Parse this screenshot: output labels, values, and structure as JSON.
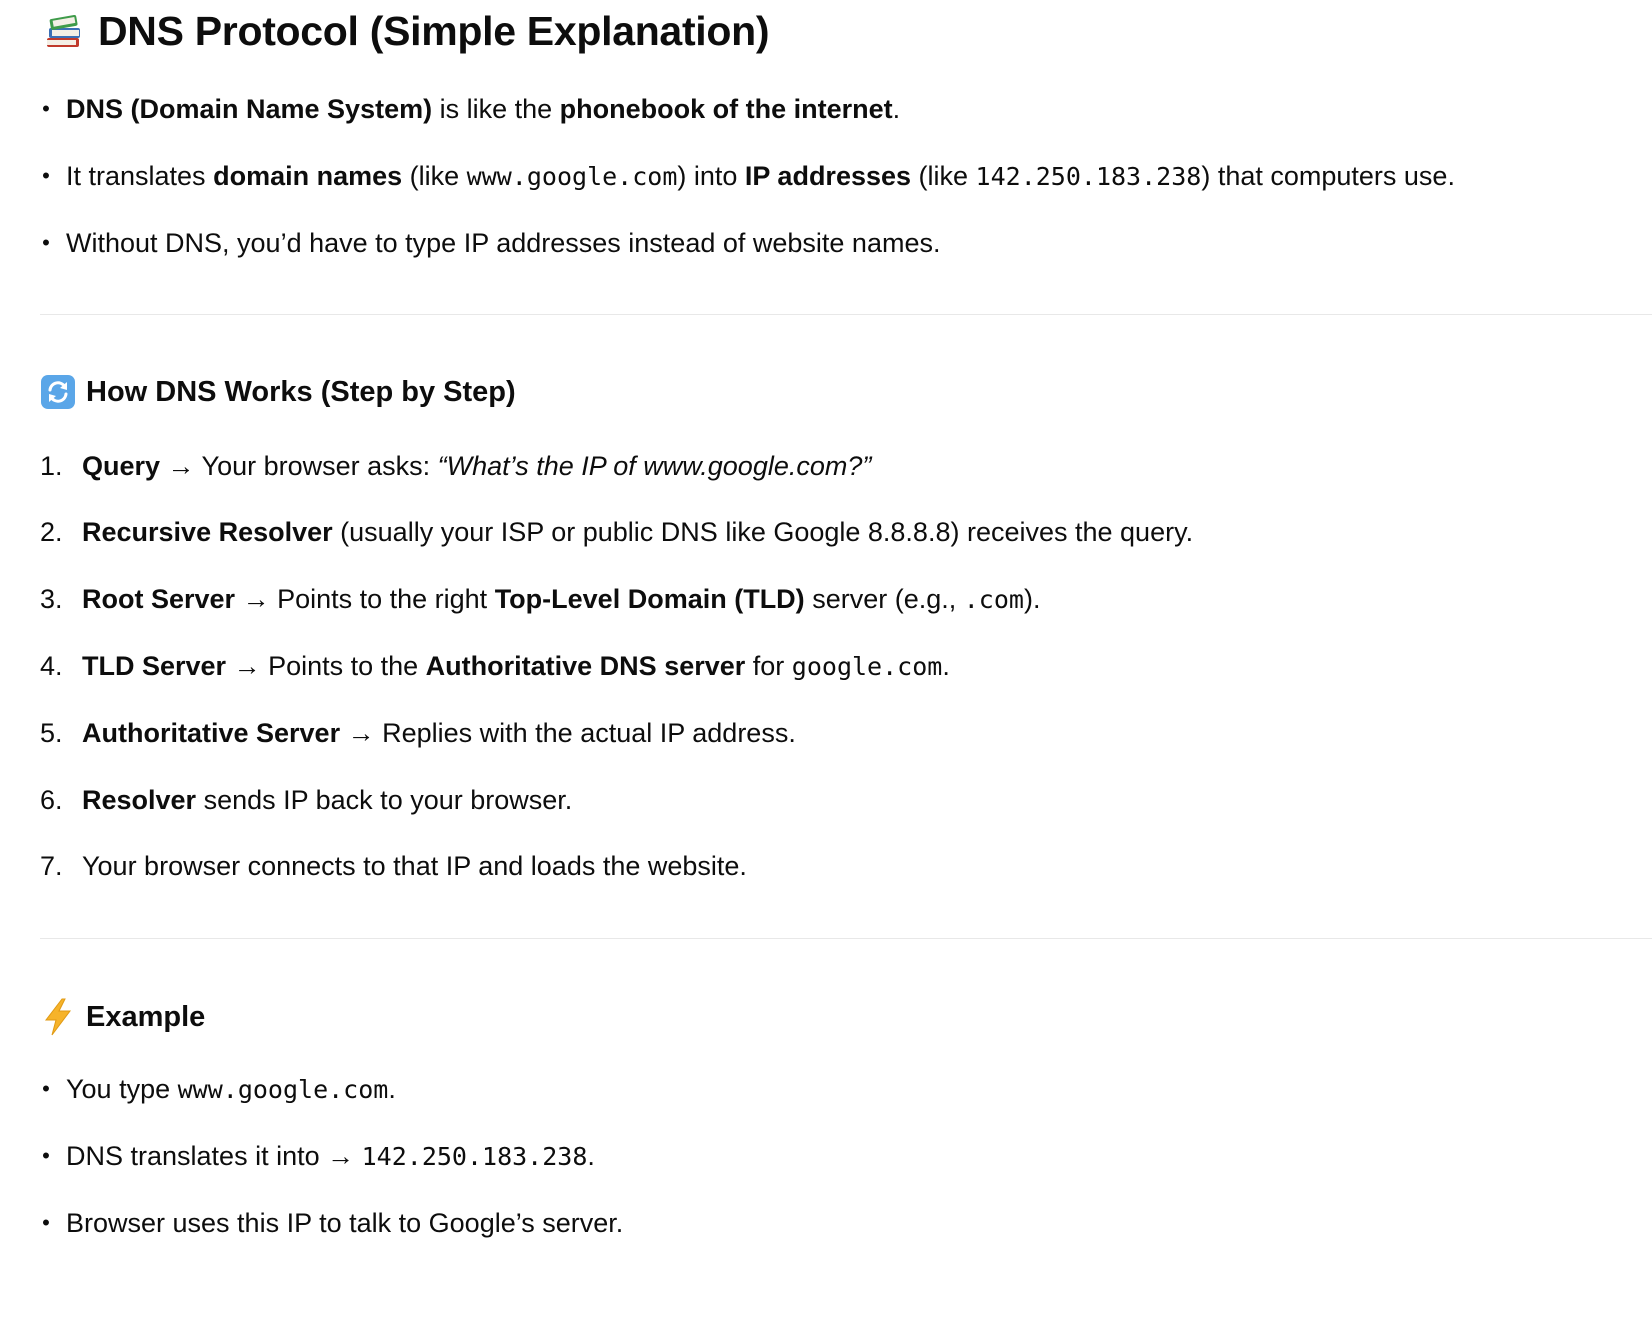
{
  "title": "DNS Protocol (Simple Explanation)",
  "intro": [
    {
      "b1": "DNS (Domain Name System)",
      "t1": " is like the ",
      "b2": "phonebook of the internet",
      "t2": "."
    },
    {
      "t1": "It translates ",
      "b1": "domain names",
      "t2": " (like ",
      "c1": "www.google.com",
      "t3": ") into ",
      "b2": "IP addresses",
      "t4": " (like ",
      "c2": "142.250.183.238",
      "t5": ") that computers use."
    },
    {
      "t1": "Without DNS, you’d have to type IP addresses instead of website names."
    }
  ],
  "section_how": {
    "heading": "How DNS Works (Step by Step)",
    "icon": "refresh-arrows-icon",
    "steps": [
      {
        "num": "1.",
        "b1": "Query",
        "t1": " → Your browser asks: ",
        "i1": "“What’s the IP of www.google.com?”"
      },
      {
        "num": "2.",
        "b1": "Recursive Resolver",
        "t1": " (usually your ISP or public DNS like Google 8.8.8.8) receives the query."
      },
      {
        "num": "3.",
        "b1": "Root Server",
        "t1": " → Points to the right ",
        "b2": "Top-Level Domain (TLD)",
        "t2": " server (e.g., ",
        "c1": ".com",
        "t3": ")."
      },
      {
        "num": "4.",
        "b1": "TLD Server",
        "t1": " → Points to the ",
        "b2": "Authoritative DNS server",
        "t2": " for ",
        "c1": "google.com",
        "t3": "."
      },
      {
        "num": "5.",
        "b1": "Authoritative Server",
        "t1": " → Replies with the actual IP address."
      },
      {
        "num": "6.",
        "b1": "Resolver",
        "t1": " sends IP back to your browser."
      },
      {
        "num": "7.",
        "t1": "Your browser connects to that IP and loads the website."
      }
    ]
  },
  "section_example": {
    "heading": "Example",
    "icon": "lightning-bolt-icon",
    "items": [
      {
        "t1": "You type ",
        "c1": "www.google.com",
        "t2": "."
      },
      {
        "t1": "DNS translates it into → ",
        "c1": "142.250.183.238",
        "t2": "."
      },
      {
        "t1": "Browser uses this IP to talk to Google’s server."
      }
    ]
  },
  "bullet_char": "•",
  "colors": {
    "text": "#0d0d0d",
    "divider": "#e8e8e8",
    "lightning": "#f6b32a",
    "refresh_blue": "#5aa6e8"
  }
}
